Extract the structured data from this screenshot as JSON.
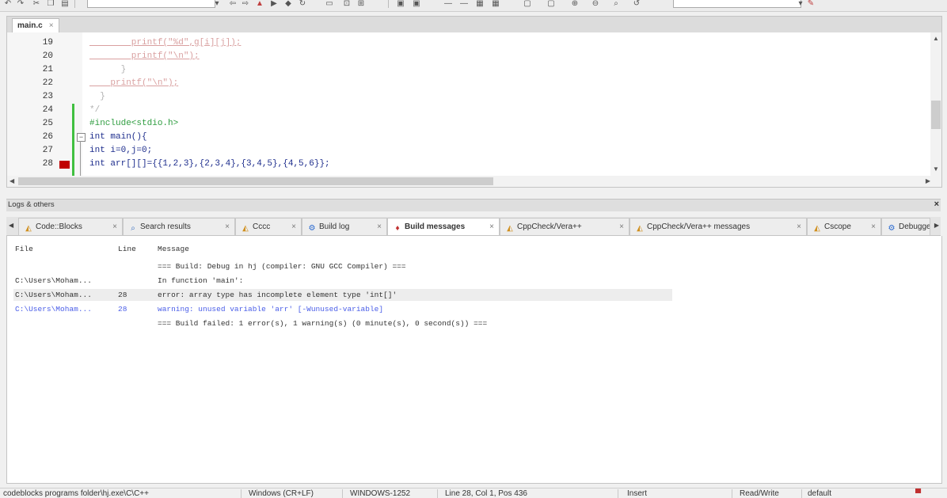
{
  "editor": {
    "tab_label": "main.c",
    "tab_close": "×",
    "lines": [
      {
        "num": "19",
        "code": "        printf(\"%d\",g[i][j]);"
      },
      {
        "num": "20",
        "code": "        printf(\"\\n\");"
      },
      {
        "num": "21",
        "code": "      }"
      },
      {
        "num": "22",
        "code": "    printf(\"\\n\");"
      },
      {
        "num": "23",
        "code": "  }"
      },
      {
        "num": "24",
        "code": "*/"
      },
      {
        "num": "25",
        "code": "#include<stdio.h>"
      },
      {
        "num": "26",
        "code": "int main(){"
      },
      {
        "num": "27",
        "code": "int i=0,j=0;"
      },
      {
        "num": "28",
        "code": "int arr[][]={{1,2,3},{2,3,4},{3,4,5},{4,5,6}};"
      }
    ]
  },
  "logs": {
    "title": "Logs & others",
    "close": "×",
    "tabs": [
      {
        "label": "Code::Blocks",
        "icon": "codeblocks-icon"
      },
      {
        "label": "Search results",
        "icon": "search-icon"
      },
      {
        "label": "Cccc",
        "icon": "codeblocks-icon"
      },
      {
        "label": "Build log",
        "icon": "gear-icon"
      },
      {
        "label": "Build messages",
        "icon": "build-messages-icon",
        "active": true
      },
      {
        "label": "CppCheck/Vera++",
        "icon": "codeblocks-icon"
      },
      {
        "label": "CppCheck/Vera++ messages",
        "icon": "codeblocks-icon"
      },
      {
        "label": "Cscope",
        "icon": "codeblocks-icon"
      },
      {
        "label": "Debugger",
        "icon": "gear-icon"
      }
    ],
    "tab_close": "×",
    "columns": {
      "file": "File",
      "line": "Line",
      "message": "Message"
    },
    "rows": [
      {
        "file": "",
        "line": "",
        "message": "=== Build: Debug in hj (compiler: GNU GCC Compiler) ==="
      },
      {
        "file": "C:\\Users\\Moham...",
        "line": "",
        "message": "In function 'main':"
      },
      {
        "file": "C:\\Users\\Moham...",
        "line": "28",
        "message": "error: array type has incomplete element type 'int[]'"
      },
      {
        "file": "C:\\Users\\Moham...",
        "line": "28",
        "message": "warning: unused variable 'arr' [-Wunused-variable]"
      },
      {
        "file": "",
        "line": "",
        "message": "=== Build failed: 1 error(s), 1 warning(s) (0 minute(s), 0 second(s)) ==="
      }
    ]
  },
  "status": {
    "path": "codeblocks programs folder\\hj.exe\\C\\C++",
    "eol": "Windows (CR+LF)",
    "encoding": "WINDOWS-1252",
    "position": "Line 28, Col 1, Pos 436",
    "mode": "Insert",
    "access": "Read/Write",
    "profile": "default"
  },
  "colors": {
    "error_marker": "#c00000",
    "change_bar": "#40c040",
    "warning_text": "#4a5ee8"
  }
}
